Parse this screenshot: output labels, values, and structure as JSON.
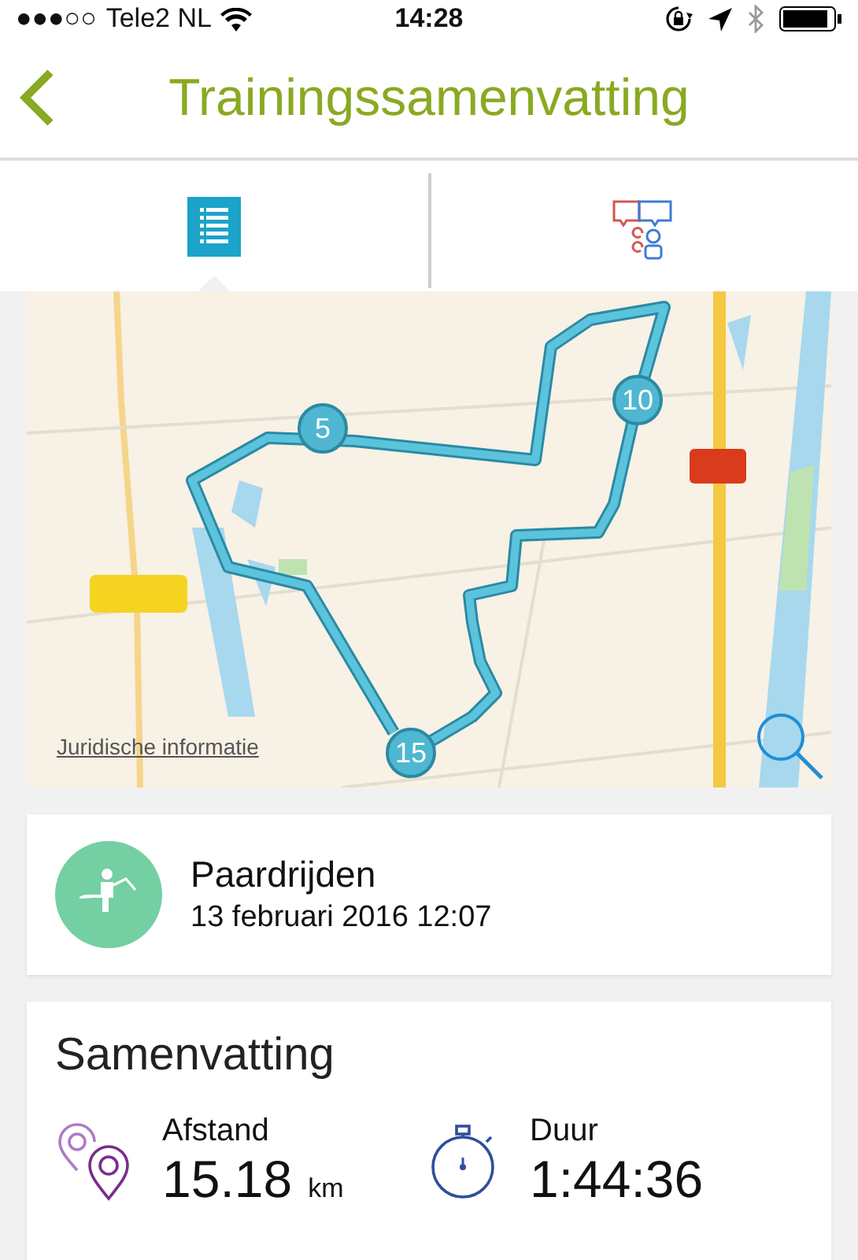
{
  "status_bar": {
    "signal": "●●●○○",
    "carrier": "Tele2 NL",
    "time": "14:28"
  },
  "nav": {
    "title": "Trainingssamenvatting"
  },
  "tabs": [
    {
      "kind": "list",
      "selected": true
    },
    {
      "kind": "social",
      "selected": false
    }
  ],
  "map": {
    "route_markers": [
      {
        "label": "5"
      },
      {
        "label": "10"
      },
      {
        "label": "15"
      }
    ],
    "legal_link": "Juridische informatie"
  },
  "activity": {
    "name": "Paardrijden",
    "datetime": "13 februari 2016 12:07"
  },
  "summary": {
    "title": "Samenvatting",
    "stats": [
      {
        "kind": "distance",
        "label": "Afstand",
        "value": "15.18",
        "unit": "km"
      },
      {
        "kind": "duration",
        "label": "Duur",
        "value": "1:44:36"
      }
    ]
  }
}
